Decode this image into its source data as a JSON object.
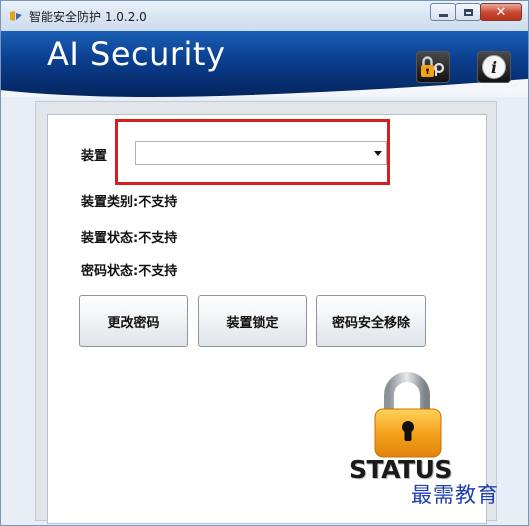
{
  "window": {
    "title": "智能安全防护 1.0.2.0",
    "buttons": {
      "minimize": "minimize",
      "maximize": "maximize",
      "close": "✕"
    }
  },
  "header": {
    "brand": "AI Security",
    "key_button_icon": "key-lock-icon",
    "info_button_icon": "info-icon",
    "info_glyph": "i"
  },
  "form": {
    "device_label": "装置",
    "device_select_value": "",
    "device_type": "装置类别:不支持",
    "device_status": "装置状态:不支持",
    "password_status": "密码状态:不支持"
  },
  "actions": {
    "change_password": "更改密码",
    "lock_device": "装置锁定",
    "remove_password": "密码安全移除"
  },
  "status": {
    "label": "STATUS",
    "icon": "padlock-icon"
  },
  "watermark": "最需教育",
  "colors": {
    "header_blue": "#0a3e8e",
    "highlight_red": "#d91e1e",
    "lock_orange": "#f39a1b",
    "watermark_blue": "#1f3fb0"
  }
}
